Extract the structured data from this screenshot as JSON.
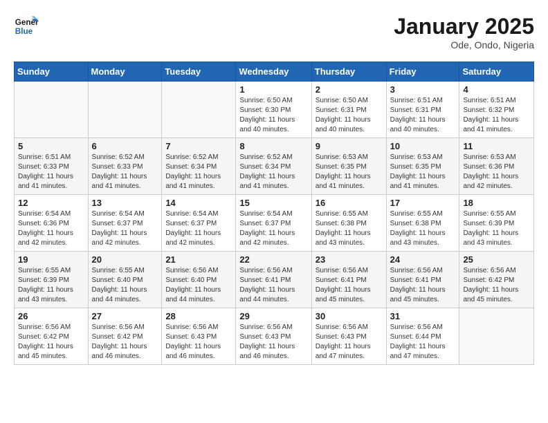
{
  "logo": {
    "line1": "General",
    "line2": "Blue"
  },
  "title": "January 2025",
  "subtitle": "Ode, Ondo, Nigeria",
  "days_of_week": [
    "Sunday",
    "Monday",
    "Tuesday",
    "Wednesday",
    "Thursday",
    "Friday",
    "Saturday"
  ],
  "weeks": [
    [
      {
        "num": "",
        "info": ""
      },
      {
        "num": "",
        "info": ""
      },
      {
        "num": "",
        "info": ""
      },
      {
        "num": "1",
        "info": "Sunrise: 6:50 AM\nSunset: 6:30 PM\nDaylight: 11 hours and 40 minutes."
      },
      {
        "num": "2",
        "info": "Sunrise: 6:50 AM\nSunset: 6:31 PM\nDaylight: 11 hours and 40 minutes."
      },
      {
        "num": "3",
        "info": "Sunrise: 6:51 AM\nSunset: 6:31 PM\nDaylight: 11 hours and 40 minutes."
      },
      {
        "num": "4",
        "info": "Sunrise: 6:51 AM\nSunset: 6:32 PM\nDaylight: 11 hours and 41 minutes."
      }
    ],
    [
      {
        "num": "5",
        "info": "Sunrise: 6:51 AM\nSunset: 6:33 PM\nDaylight: 11 hours and 41 minutes."
      },
      {
        "num": "6",
        "info": "Sunrise: 6:52 AM\nSunset: 6:33 PM\nDaylight: 11 hours and 41 minutes."
      },
      {
        "num": "7",
        "info": "Sunrise: 6:52 AM\nSunset: 6:34 PM\nDaylight: 11 hours and 41 minutes."
      },
      {
        "num": "8",
        "info": "Sunrise: 6:52 AM\nSunset: 6:34 PM\nDaylight: 11 hours and 41 minutes."
      },
      {
        "num": "9",
        "info": "Sunrise: 6:53 AM\nSunset: 6:35 PM\nDaylight: 11 hours and 41 minutes."
      },
      {
        "num": "10",
        "info": "Sunrise: 6:53 AM\nSunset: 6:35 PM\nDaylight: 11 hours and 41 minutes."
      },
      {
        "num": "11",
        "info": "Sunrise: 6:53 AM\nSunset: 6:36 PM\nDaylight: 11 hours and 42 minutes."
      }
    ],
    [
      {
        "num": "12",
        "info": "Sunrise: 6:54 AM\nSunset: 6:36 PM\nDaylight: 11 hours and 42 minutes."
      },
      {
        "num": "13",
        "info": "Sunrise: 6:54 AM\nSunset: 6:37 PM\nDaylight: 11 hours and 42 minutes."
      },
      {
        "num": "14",
        "info": "Sunrise: 6:54 AM\nSunset: 6:37 PM\nDaylight: 11 hours and 42 minutes."
      },
      {
        "num": "15",
        "info": "Sunrise: 6:54 AM\nSunset: 6:37 PM\nDaylight: 11 hours and 42 minutes."
      },
      {
        "num": "16",
        "info": "Sunrise: 6:55 AM\nSunset: 6:38 PM\nDaylight: 11 hours and 43 minutes."
      },
      {
        "num": "17",
        "info": "Sunrise: 6:55 AM\nSunset: 6:38 PM\nDaylight: 11 hours and 43 minutes."
      },
      {
        "num": "18",
        "info": "Sunrise: 6:55 AM\nSunset: 6:39 PM\nDaylight: 11 hours and 43 minutes."
      }
    ],
    [
      {
        "num": "19",
        "info": "Sunrise: 6:55 AM\nSunset: 6:39 PM\nDaylight: 11 hours and 43 minutes."
      },
      {
        "num": "20",
        "info": "Sunrise: 6:55 AM\nSunset: 6:40 PM\nDaylight: 11 hours and 44 minutes."
      },
      {
        "num": "21",
        "info": "Sunrise: 6:56 AM\nSunset: 6:40 PM\nDaylight: 11 hours and 44 minutes."
      },
      {
        "num": "22",
        "info": "Sunrise: 6:56 AM\nSunset: 6:41 PM\nDaylight: 11 hours and 44 minutes."
      },
      {
        "num": "23",
        "info": "Sunrise: 6:56 AM\nSunset: 6:41 PM\nDaylight: 11 hours and 45 minutes."
      },
      {
        "num": "24",
        "info": "Sunrise: 6:56 AM\nSunset: 6:41 PM\nDaylight: 11 hours and 45 minutes."
      },
      {
        "num": "25",
        "info": "Sunrise: 6:56 AM\nSunset: 6:42 PM\nDaylight: 11 hours and 45 minutes."
      }
    ],
    [
      {
        "num": "26",
        "info": "Sunrise: 6:56 AM\nSunset: 6:42 PM\nDaylight: 11 hours and 45 minutes."
      },
      {
        "num": "27",
        "info": "Sunrise: 6:56 AM\nSunset: 6:42 PM\nDaylight: 11 hours and 46 minutes."
      },
      {
        "num": "28",
        "info": "Sunrise: 6:56 AM\nSunset: 6:43 PM\nDaylight: 11 hours and 46 minutes."
      },
      {
        "num": "29",
        "info": "Sunrise: 6:56 AM\nSunset: 6:43 PM\nDaylight: 11 hours and 46 minutes."
      },
      {
        "num": "30",
        "info": "Sunrise: 6:56 AM\nSunset: 6:43 PM\nDaylight: 11 hours and 47 minutes."
      },
      {
        "num": "31",
        "info": "Sunrise: 6:56 AM\nSunset: 6:44 PM\nDaylight: 11 hours and 47 minutes."
      },
      {
        "num": "",
        "info": ""
      }
    ]
  ]
}
